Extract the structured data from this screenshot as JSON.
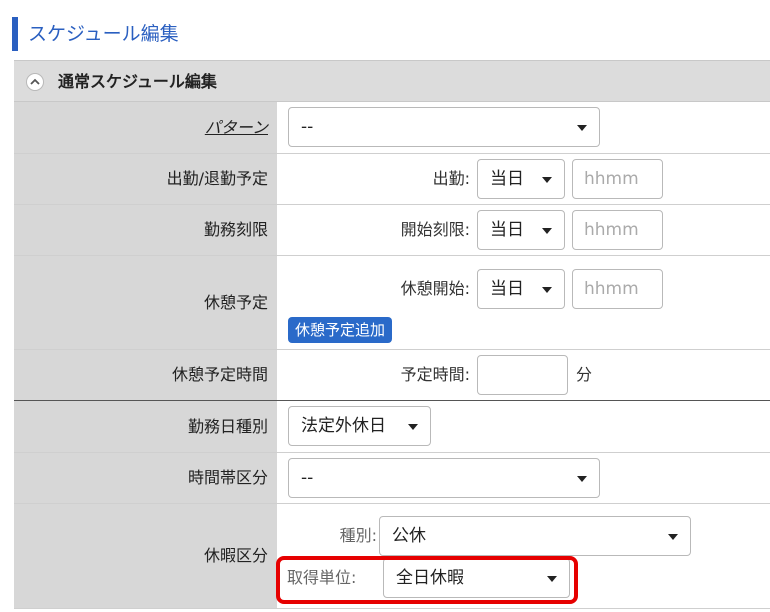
{
  "page_title": "スケジュール編集",
  "section": {
    "title": "通常スケジュール編集"
  },
  "rows": {
    "pattern": {
      "label": "パターン",
      "select_value": "--"
    },
    "attendance": {
      "label": "出勤/退勤予定",
      "field_label": "出勤:",
      "day_value": "当日",
      "time_placeholder": "hhmm"
    },
    "work_limit": {
      "label": "勤務刻限",
      "field_label": "開始刻限:",
      "day_value": "当日",
      "time_placeholder": "hhmm"
    },
    "break_plan": {
      "label": "休憩予定",
      "field_label": "休憩開始:",
      "day_value": "当日",
      "time_placeholder": "hhmm",
      "add_button": "休憩予定追加"
    },
    "break_time": {
      "label": "休憩予定時間",
      "field_label": "予定時間:",
      "input_value": "",
      "unit": "分"
    },
    "workday_type": {
      "label": "勤務日種別",
      "select_value": "法定外休日"
    },
    "time_zone": {
      "label": "時間帯区分",
      "select_value": "--"
    },
    "leave": {
      "label": "休暇区分",
      "type_label": "種別:",
      "type_value": "公休",
      "unit_label": "取得単位:",
      "unit_value": "全日休暇"
    }
  },
  "colors": {
    "accent": "#2a5fc0",
    "button": "#2a6ac9",
    "highlight": "#e60000",
    "label_bg": "#d7d7d7"
  }
}
